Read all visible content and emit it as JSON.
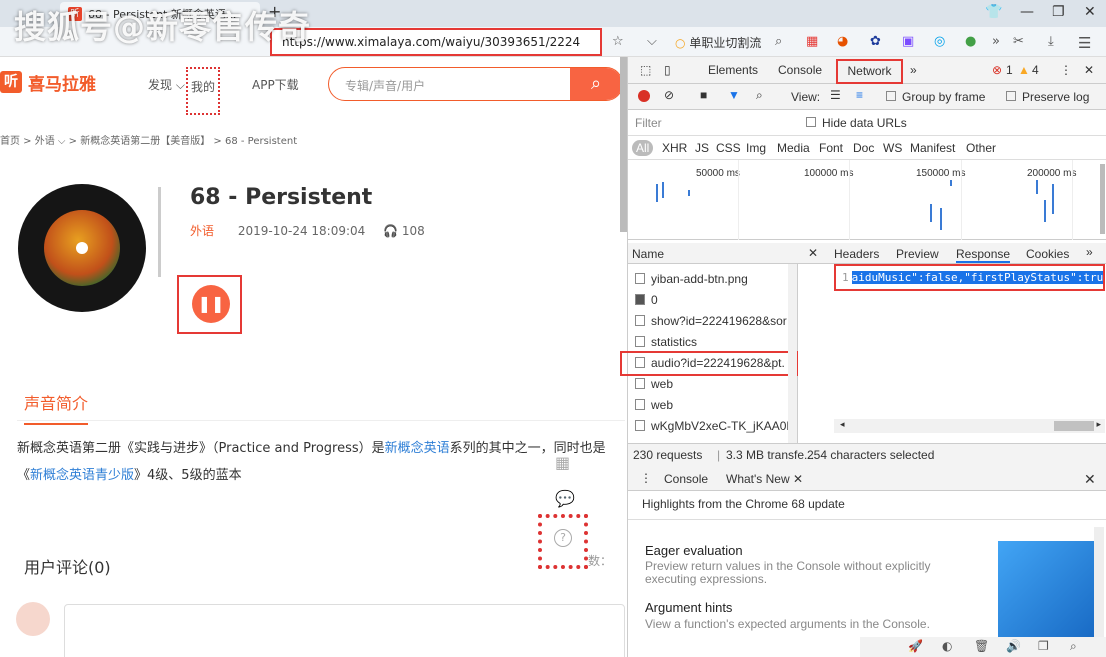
{
  "browser": {
    "tab_title": "68 - Persistent 新概念英语...",
    "address": "https://www.ximalaya.com/waiyu/30393651/2224",
    "watermark": "搜狐号@新零售传奇",
    "toolbar_items": [
      "单职业切割流"
    ]
  },
  "site": {
    "logo_icon": "听",
    "logo_text": "喜马拉雅",
    "nav": [
      "发现",
      "我的",
      "APP下载"
    ],
    "search_placeholder": "专辑/声音/用户",
    "breadcrumb": "首页 > 外语 ⌵ > 新概念英语第二册【美音版】 > 68 - Persistent",
    "track_title": "68 - Persistent",
    "category": "外语",
    "date": "2019-10-24 18:09:04",
    "plays": "108",
    "play_symbol": "❚❚",
    "tab_intro": "声音简介",
    "desc_part1": "新概念英语第二册《实践与进步》（Practice and Progress）是",
    "desc_link": "新概念英语",
    "desc_part2": "系列的其中之一，同时也是",
    "desc_link2": "新概念英语青少版",
    "desc_part3": "》4级、5级的蓝本",
    "comments_title": "用户评论(0)",
    "side_label": "数："
  },
  "devtools": {
    "tabs": [
      "Elements",
      "Console",
      "Network"
    ],
    "errors": "1",
    "warnings": "4",
    "filter_placeholder": "Filter",
    "hide_data_urls": "Hide data URLs",
    "view_label": "View:",
    "group_by_frame": "Group by frame",
    "preserve_log": "Preserve log",
    "type_filters": [
      "All",
      "XHR",
      "JS",
      "CSS",
      "Img",
      "Media",
      "Font",
      "Doc",
      "WS",
      "Manifest",
      "Other"
    ],
    "timeline_labels": [
      "50000 ms",
      "100000 ms",
      "150000 ms",
      "200000 ms"
    ],
    "name_header": "Name",
    "detail_tabs": [
      "Headers",
      "Preview",
      "Response",
      "Cookies"
    ],
    "requests": [
      "yiban-add-btn.png",
      "0",
      "show?id=222419628&sor",
      "statistics",
      "audio?id=222419628&pt.",
      "web",
      "web",
      "wKgMbV2xeC-TK_jKAA0P"
    ],
    "response_line_no": "1",
    "response_text": "aiduMusic\":false,\"firstPlayStatus\":true}}",
    "status_requests": "230 requests",
    "status_transfer": "3.3 MB transfe...",
    "status_selected": "254 characters selected",
    "drawer_tabs": [
      "Console",
      "What's New"
    ],
    "highlights": "Highlights from the Chrome 68 update",
    "feature1_title": "Eager evaluation",
    "feature1_desc": "Preview return values in the Console without explicitly executing expressions.",
    "feature2_title": "Argument hints",
    "feature2_desc": "View a function's expected arguments in the Console."
  }
}
